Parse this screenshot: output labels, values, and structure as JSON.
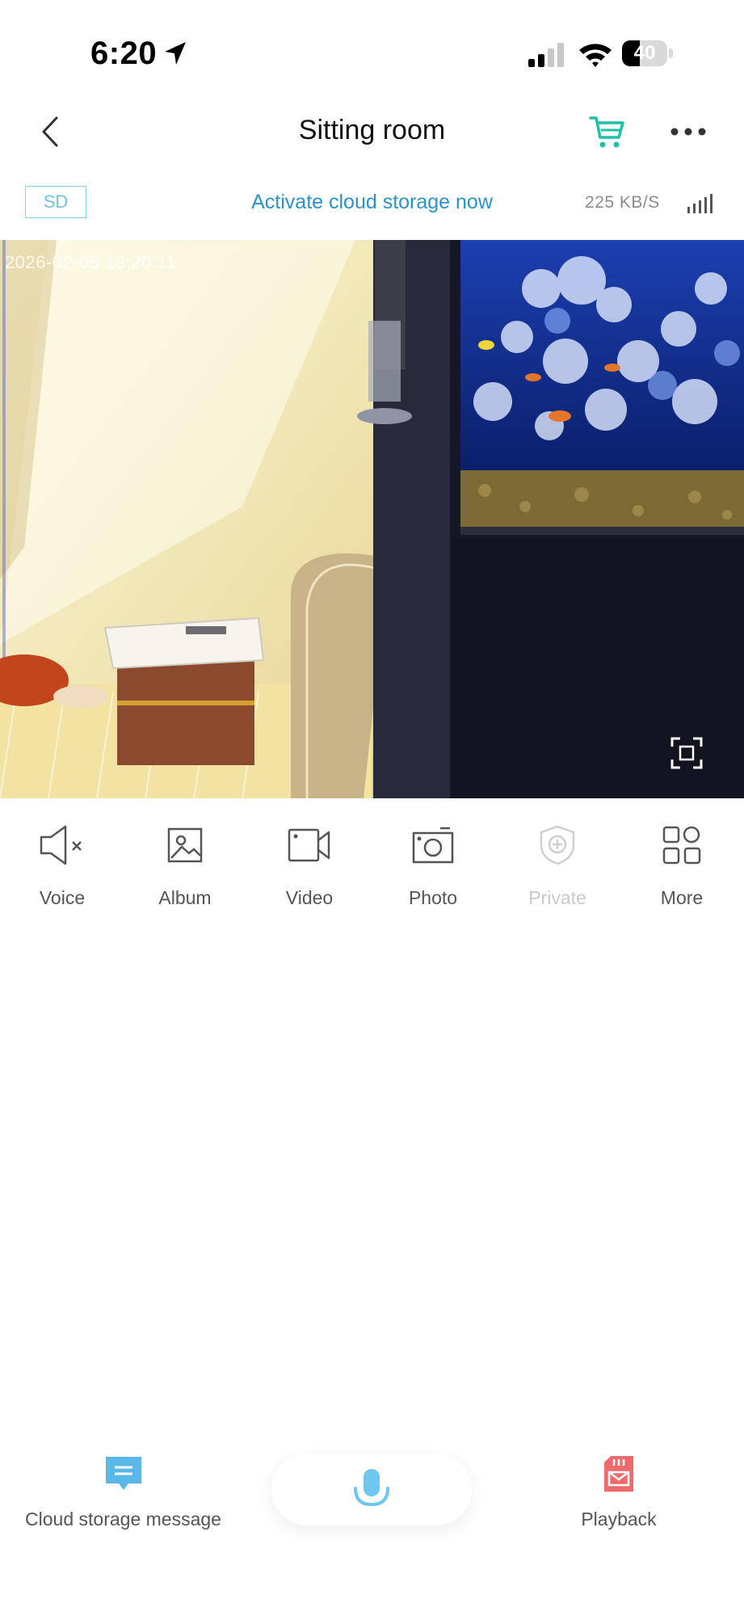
{
  "status_bar": {
    "time": "6:20",
    "battery": "40",
    "battery_level": 0.4
  },
  "nav": {
    "title": "Sitting room"
  },
  "info": {
    "sd_label": "SD",
    "cloud_link": "Activate cloud storage now",
    "speed": "225 KB/S"
  },
  "video": {
    "timestamp": "2026-02-05 18:20:11"
  },
  "controls": [
    {
      "label": "Voice",
      "icon": "speaker-muted-icon",
      "enabled": true
    },
    {
      "label": "Album",
      "icon": "album-icon",
      "enabled": true
    },
    {
      "label": "Video",
      "icon": "video-camera-icon",
      "enabled": true
    },
    {
      "label": "Photo",
      "icon": "camera-icon",
      "enabled": true
    },
    {
      "label": "Private",
      "icon": "shield-plus-icon",
      "enabled": false
    },
    {
      "label": "More",
      "icon": "grid-icon",
      "enabled": true
    }
  ],
  "bottom": {
    "cloud_label": "Cloud storage message",
    "playback_label": "Playback"
  },
  "colors": {
    "accent": "#2a93c9",
    "cart": "#1fc0a8",
    "cloud_icon": "#5ab8e8",
    "playback_icon": "#ef6b6b",
    "mic": "#6fc6ee"
  }
}
